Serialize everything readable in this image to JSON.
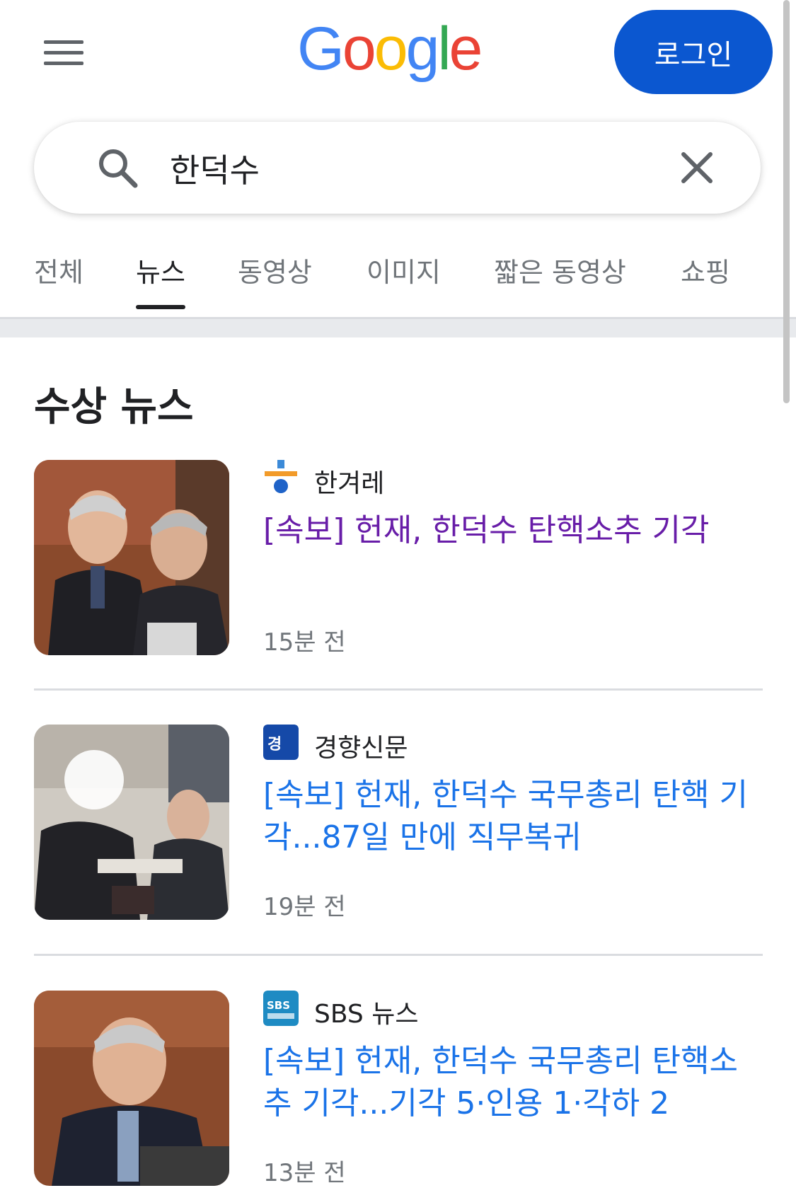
{
  "header": {
    "logo_text": "Google",
    "login_label": "로그인",
    "colors": {
      "login_bg": "#0b57d0",
      "g_blue": "#4285f4",
      "o_red": "#ea4335",
      "o_yellow": "#fbbc05",
      "g_green": "#34a853"
    }
  },
  "search": {
    "query": "한덕수"
  },
  "tabs": [
    {
      "label": "전체",
      "active": false
    },
    {
      "label": "뉴스",
      "active": true
    },
    {
      "label": "동영상",
      "active": false
    },
    {
      "label": "이미지",
      "active": false
    },
    {
      "label": "짧은 동영상",
      "active": false
    },
    {
      "label": "쇼핑",
      "active": false
    }
  ],
  "section": {
    "title": "수상 뉴스"
  },
  "news": [
    {
      "source": "한겨레",
      "source_icon": "hankyoreh-logo",
      "headline": "[속보] 헌재, 한덕수 탄핵소추 기각",
      "visited": true,
      "time": "15분 전"
    },
    {
      "source": "경향신문",
      "source_icon": "kyunghyang-logo",
      "headline": "[속보] 헌재, 한덕수 국무총리 탄핵 기각...87일 만에 직무복귀",
      "visited": false,
      "time": "19분 전"
    },
    {
      "source": "SBS 뉴스",
      "source_icon": "sbs-news-logo",
      "headline": "[속보] 헌재, 한덕수 국무총리 탄핵소추 기각...기각 5·인용 1·각하 2",
      "visited": false,
      "time": "13분 전"
    }
  ]
}
